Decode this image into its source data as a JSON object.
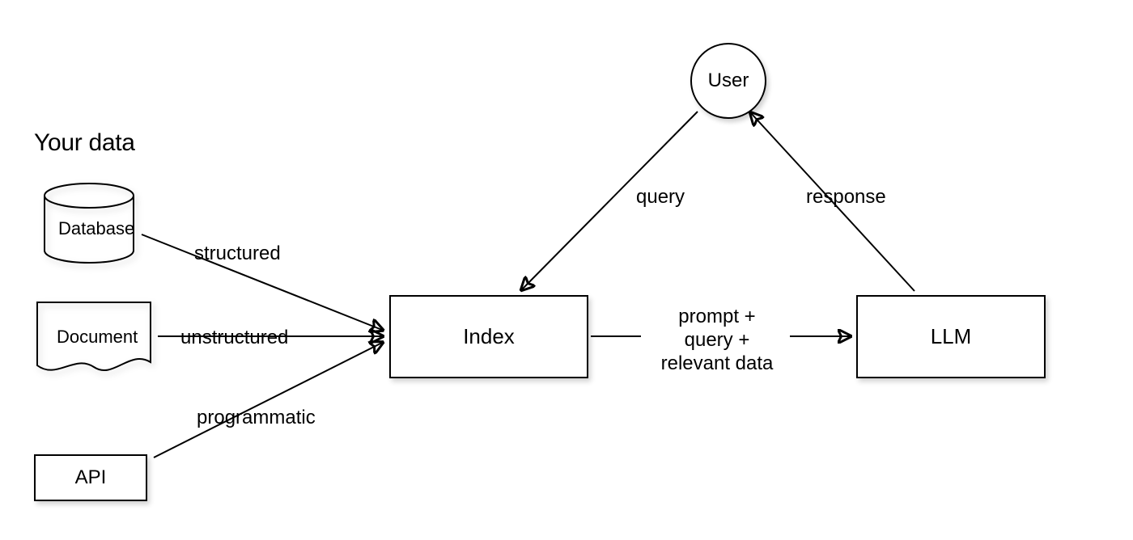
{
  "heading": "Your data",
  "nodes": {
    "user": "User",
    "index": "Index",
    "llm": "LLM",
    "database": "Database",
    "document": "Document",
    "api": "API"
  },
  "edges": {
    "structured": "structured",
    "unstructured": "unstructured",
    "programmatic": "programmatic",
    "query": "query",
    "response": "response",
    "prompt": "prompt +\nquery +\nrelevant data"
  }
}
